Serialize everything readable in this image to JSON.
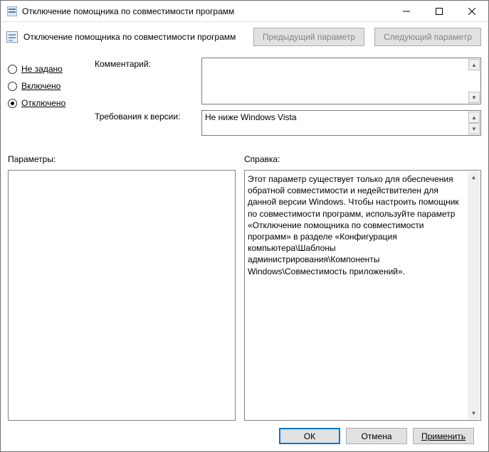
{
  "window": {
    "title": "Отключение помощника по совместимости программ"
  },
  "header": {
    "title": "Отключение помощника по совместимости программ",
    "prev_label": "Предыдущий параметр",
    "next_label": "Следующий параметр"
  },
  "radios": {
    "not_configured": "Не задано",
    "enabled": "Включено",
    "disabled": "Отключено",
    "selected": "disabled"
  },
  "fields": {
    "comment_label": "Комментарий:",
    "comment_value": "",
    "version_label": "Требования к версии:",
    "version_value": "Не ниже Windows Vista"
  },
  "panels": {
    "params_label": "Параметры:",
    "help_label": "Справка:",
    "help_text": "Этот параметр существует только для обеспечения обратной совместимости и недействителен для данной версии Windows. Чтобы настроить помощник по совместимости программ, используйте параметр «Отключение помощника по совместимости программ» в разделе «Конфигурация компьютера\\Шаблоны администрирования\\Компоненты Windows\\Совместимость приложений»."
  },
  "footer": {
    "ok": "ОК",
    "cancel": "Отмена",
    "apply": "Применить"
  }
}
